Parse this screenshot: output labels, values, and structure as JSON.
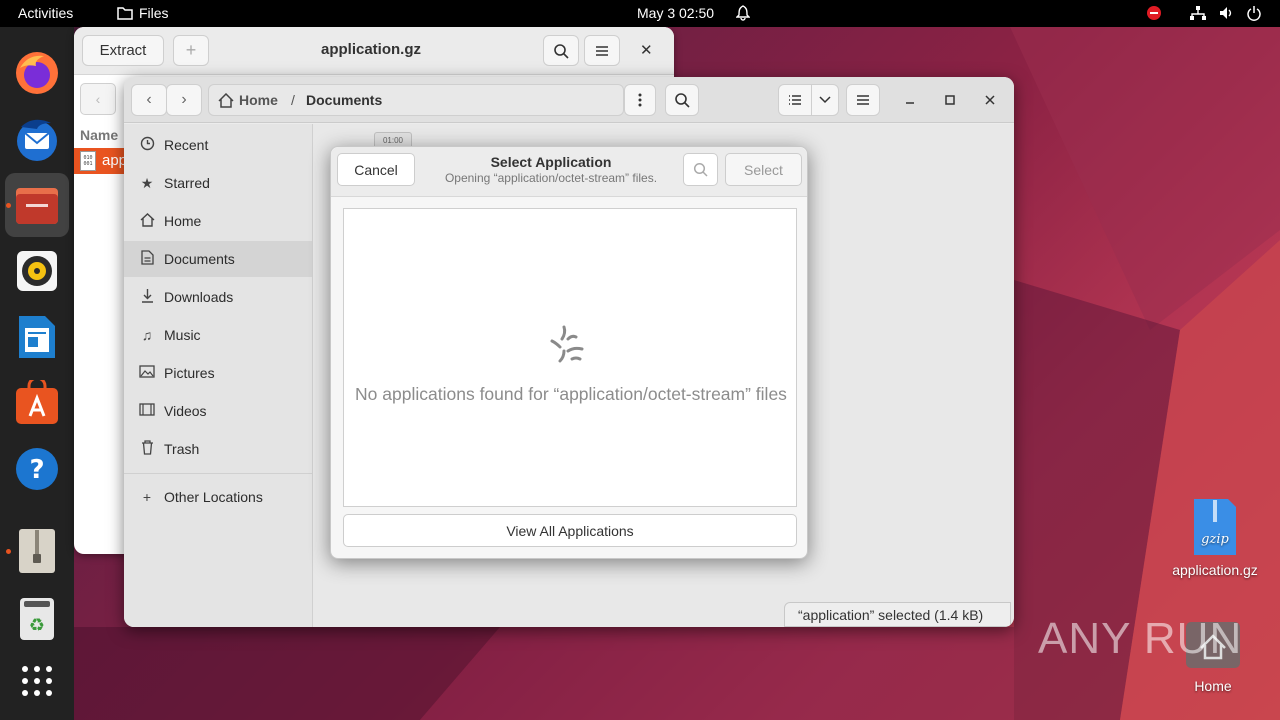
{
  "topbar": {
    "activities": "Activities",
    "app_name": "Files",
    "datetime": "May 3  02:50"
  },
  "archive_window": {
    "extract_label": "Extract",
    "add_label": "+",
    "title": "application.gz",
    "column_name": "Name",
    "row_name": "app"
  },
  "files_window": {
    "path_home": "Home",
    "path_separator": "/",
    "path_current": "Documents",
    "sidebar": [
      {
        "icon": "clock-icon",
        "label": "Recent"
      },
      {
        "icon": "star-icon",
        "label": "Starred"
      },
      {
        "icon": "home-icon",
        "label": "Home"
      },
      {
        "icon": "document-icon",
        "label": "Documents"
      },
      {
        "icon": "download-icon",
        "label": "Downloads"
      },
      {
        "icon": "music-icon",
        "label": "Music"
      },
      {
        "icon": "picture-icon",
        "label": "Pictures"
      },
      {
        "icon": "video-icon",
        "label": "Videos"
      },
      {
        "icon": "trash-icon",
        "label": "Trash"
      },
      {
        "icon": "plus-icon",
        "label": "Other Locations"
      }
    ],
    "selected_sidebar": "Documents",
    "file_thumb_label": "01:00",
    "status": "“application” selected  (1.4 kB)"
  },
  "dialog": {
    "cancel_label": "Cancel",
    "title": "Select Application",
    "subtitle": "Opening “application/octet-stream” files.",
    "select_label": "Select",
    "empty_message": "No applications found for “application/octet-stream” files",
    "view_all_label": "View All Applications"
  },
  "desktop": {
    "file_icon_text": "gzip",
    "file_label": "application.gz",
    "home_label": "Home",
    "watermark": "ANY RUN"
  },
  "colors": {
    "accent": "#e95420",
    "topbar": "#000000",
    "dock": "#222222"
  }
}
